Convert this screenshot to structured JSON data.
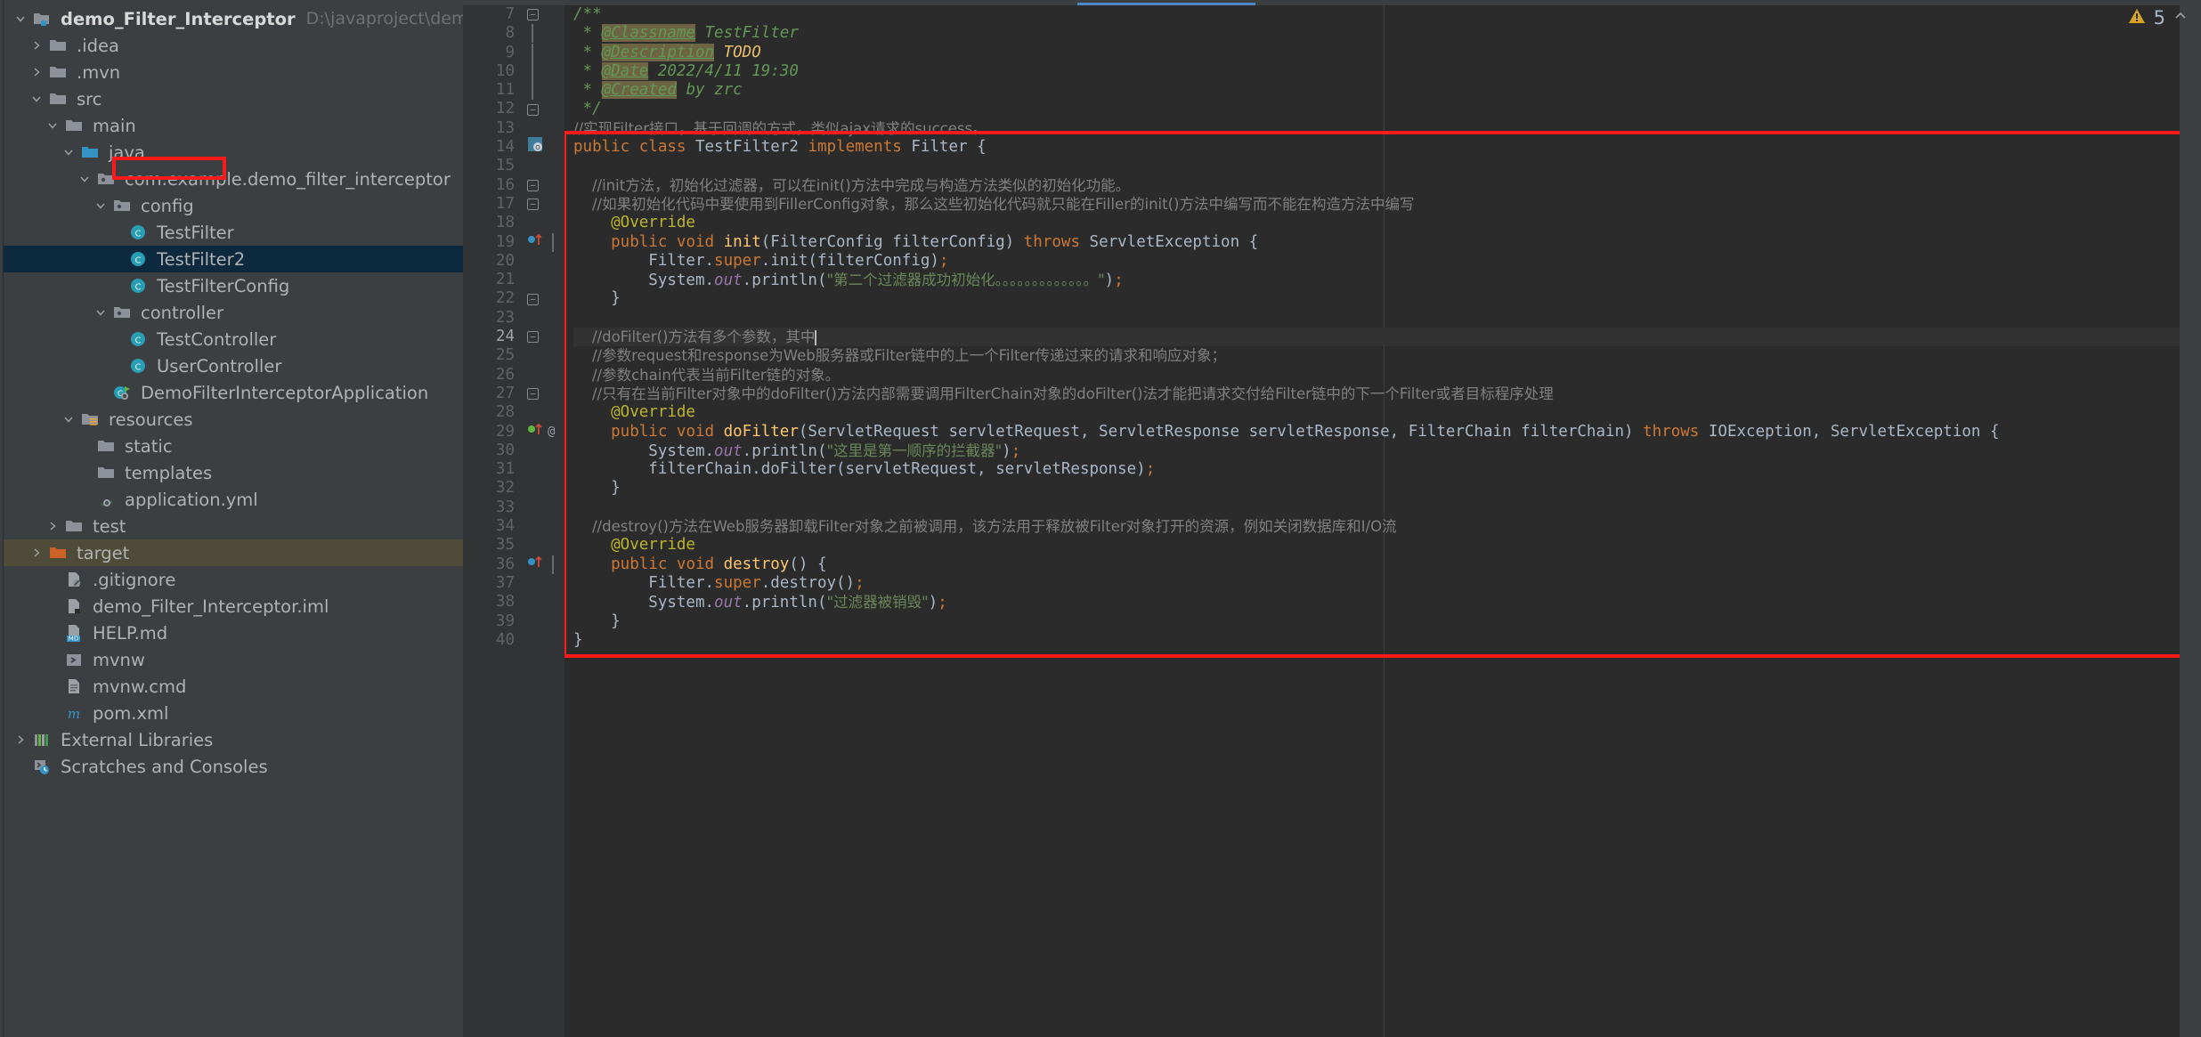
{
  "project_tree": {
    "items": [
      {
        "label": "demo_Filter_Interceptor",
        "path_hint": "D:\\javaproject\\demo_Filt",
        "indent": 0,
        "arrow": "down",
        "icon": "module-folder-icon",
        "bold": true,
        "state": "normal"
      },
      {
        "label": ".idea",
        "indent": 1,
        "arrow": "right",
        "icon": "folder-icon",
        "state": "normal"
      },
      {
        "label": ".mvn",
        "indent": 1,
        "arrow": "right",
        "icon": "folder-icon",
        "state": "normal"
      },
      {
        "label": "src",
        "indent": 1,
        "arrow": "down",
        "icon": "folder-icon",
        "state": "normal"
      },
      {
        "label": "main",
        "indent": 2,
        "arrow": "down",
        "icon": "folder-icon",
        "state": "normal"
      },
      {
        "label": "java",
        "indent": 3,
        "arrow": "down",
        "icon": "source-folder-icon",
        "state": "normal"
      },
      {
        "label": "com.example.demo_filter_interceptor",
        "indent": 4,
        "arrow": "down",
        "icon": "package-icon",
        "state": "normal"
      },
      {
        "label": "config",
        "indent": 5,
        "arrow": "down",
        "icon": "package-icon",
        "state": "normal"
      },
      {
        "label": "TestFilter",
        "indent": 6,
        "arrow": "none",
        "icon": "java-class-icon",
        "state": "normal"
      },
      {
        "label": "TestFilter2",
        "indent": 6,
        "arrow": "none",
        "icon": "java-class-icon",
        "state": "selected"
      },
      {
        "label": "TestFilterConfig",
        "indent": 6,
        "arrow": "none",
        "icon": "java-class-icon",
        "state": "normal"
      },
      {
        "label": "controller",
        "indent": 5,
        "arrow": "down",
        "icon": "package-icon",
        "state": "normal"
      },
      {
        "label": "TestController",
        "indent": 6,
        "arrow": "none",
        "icon": "java-class-icon",
        "state": "normal"
      },
      {
        "label": "UserController",
        "indent": 6,
        "arrow": "none",
        "icon": "java-class-icon",
        "state": "normal"
      },
      {
        "label": "DemoFilterInterceptorApplication",
        "indent": 5,
        "arrow": "none",
        "icon": "spring-boot-class-icon",
        "state": "normal"
      },
      {
        "label": "resources",
        "indent": 3,
        "arrow": "down",
        "icon": "resources-folder-icon",
        "state": "normal"
      },
      {
        "label": "static",
        "indent": 4,
        "arrow": "none",
        "icon": "folder-icon",
        "state": "normal"
      },
      {
        "label": "templates",
        "indent": 4,
        "arrow": "none",
        "icon": "folder-icon",
        "state": "normal"
      },
      {
        "label": "application.yml",
        "indent": 4,
        "arrow": "none",
        "icon": "spring-yaml-icon",
        "state": "normal"
      },
      {
        "label": "test",
        "indent": 2,
        "arrow": "right",
        "icon": "folder-icon",
        "state": "normal"
      },
      {
        "label": "target",
        "indent": 1,
        "arrow": "right",
        "icon": "excluded-folder-icon",
        "state": "highlight"
      },
      {
        "label": ".gitignore",
        "indent": 2,
        "arrow": "none",
        "icon": "gitignore-file-icon",
        "state": "normal"
      },
      {
        "label": "demo_Filter_Interceptor.iml",
        "indent": 2,
        "arrow": "none",
        "icon": "iml-file-icon",
        "state": "normal"
      },
      {
        "label": "HELP.md",
        "indent": 2,
        "arrow": "none",
        "icon": "markdown-file-icon",
        "state": "normal"
      },
      {
        "label": "mvnw",
        "indent": 2,
        "arrow": "none",
        "icon": "shell-script-icon",
        "state": "normal"
      },
      {
        "label": "mvnw.cmd",
        "indent": 2,
        "arrow": "none",
        "icon": "cmd-file-icon",
        "state": "normal"
      },
      {
        "label": "pom.xml",
        "indent": 2,
        "arrow": "none",
        "icon": "maven-pom-icon",
        "state": "normal"
      },
      {
        "label": "External Libraries",
        "indent": 0,
        "arrow": "right",
        "icon": "external-libraries-icon",
        "state": "normal"
      },
      {
        "label": "Scratches and Consoles",
        "indent": 0,
        "arrow": "none",
        "icon": "scratches-icon",
        "state": "normal"
      }
    ]
  },
  "editor": {
    "first_line_number": 7,
    "current_line_number": 24,
    "caret_line_number": 24,
    "lines": [
      {
        "n": 7,
        "mark": "fold-open",
        "tokens": [
          {
            "t": "/**",
            "c": "jdoc"
          }
        ]
      },
      {
        "n": 8,
        "mark": "fold-bar",
        "tokens": [
          {
            "t": " * ",
            "c": "jdoc"
          },
          {
            "t": "@Classname",
            "c": "jtag"
          },
          {
            "t": " TestFilter",
            "c": "jval"
          }
        ]
      },
      {
        "n": 9,
        "mark": "fold-bar",
        "tokens": [
          {
            "t": " * ",
            "c": "jdoc"
          },
          {
            "t": "@Description",
            "c": "jtag"
          },
          {
            "t": " ",
            "c": "jval"
          },
          {
            "t": "TODO",
            "c": "todo"
          }
        ]
      },
      {
        "n": 10,
        "mark": "fold-bar",
        "tokens": [
          {
            "t": " * ",
            "c": "jdoc"
          },
          {
            "t": "@Date",
            "c": "jtag"
          },
          {
            "t": " 2022/4/11 19:30",
            "c": "jval"
          }
        ]
      },
      {
        "n": 11,
        "mark": "fold-bar",
        "tokens": [
          {
            "t": " * ",
            "c": "jdoc"
          },
          {
            "t": "@Created",
            "c": "jtag"
          },
          {
            "t": " by zrc",
            "c": "jval"
          }
        ]
      },
      {
        "n": 12,
        "mark": "fold-close",
        "tokens": [
          {
            "t": " */",
            "c": "jdoc"
          }
        ]
      },
      {
        "n": 13,
        "mark": "",
        "tokens": [
          {
            "t": "//实现Filter接口，基于回调的方式，类似ajax请求的success。",
            "c": "cmt"
          }
        ]
      },
      {
        "n": 14,
        "mark": "impl-gutter",
        "tokens": [
          {
            "t": "public ",
            "c": "kw"
          },
          {
            "t": "class ",
            "c": "kw"
          },
          {
            "t": "TestFilter2 ",
            "c": "cls"
          },
          {
            "t": "implements ",
            "c": "kw"
          },
          {
            "t": "Filter {",
            "c": "cls"
          }
        ]
      },
      {
        "n": 15,
        "mark": "",
        "tokens": [
          {
            "t": "",
            "c": "plain"
          }
        ]
      },
      {
        "n": 16,
        "mark": "fold-open-sm",
        "tokens": [
          {
            "t": "    //init方法，初始化过滤器，可以在init()方法中完成与构造方法类似的初始化功能。",
            "c": "cmt"
          }
        ]
      },
      {
        "n": 17,
        "mark": "fold-close-sm",
        "tokens": [
          {
            "t": "    //如果初始化代码中要使用到FillerConfig对象，那么这些初始化代码就只能在Filler的init()方法中编写而不能在构造方法中编写",
            "c": "cmt"
          }
        ]
      },
      {
        "n": 18,
        "mark": "",
        "tokens": [
          {
            "t": "    @Override",
            "c": "anno"
          }
        ]
      },
      {
        "n": 19,
        "mark": "override-impl",
        "tokens": [
          {
            "t": "    public ",
            "c": "kw"
          },
          {
            "t": "void ",
            "c": "kw"
          },
          {
            "t": "init",
            "c": "meth"
          },
          {
            "t": "(FilterConfig filterConfig) ",
            "c": "plain"
          },
          {
            "t": "throws ",
            "c": "kw"
          },
          {
            "t": "ServletException {",
            "c": "plain"
          }
        ]
      },
      {
        "n": 20,
        "mark": "",
        "tokens": [
          {
            "t": "        Filter.",
            "c": "plain"
          },
          {
            "t": "super",
            "c": "kw"
          },
          {
            "t": ".init(filterConfig)",
            "c": "plain"
          },
          {
            "t": ";",
            "c": "kw"
          }
        ]
      },
      {
        "n": 21,
        "mark": "",
        "tokens": [
          {
            "t": "        System.",
            "c": "plain"
          },
          {
            "t": "out",
            "c": "fld"
          },
          {
            "t": ".println(",
            "c": "plain"
          },
          {
            "t": "\"第二个过滤器成功初始化。。。。。。。。。。。。。\"",
            "c": "str"
          },
          {
            "t": ")",
            "c": "plain"
          },
          {
            "t": ";",
            "c": "kw"
          }
        ]
      },
      {
        "n": 22,
        "mark": "fold-close-sm",
        "tokens": [
          {
            "t": "    }",
            "c": "plain"
          }
        ]
      },
      {
        "n": 23,
        "mark": "",
        "tokens": [
          {
            "t": "",
            "c": "plain"
          }
        ]
      },
      {
        "n": 24,
        "mark": "fold-open-sm",
        "tokens": [
          {
            "t": "    //doFilter()方法有多个参数，其中",
            "c": "cmt"
          }
        ]
      },
      {
        "n": 25,
        "mark": "",
        "tokens": [
          {
            "t": "    //参数request和response为Web服务器或Filter链中的上一个Filter传递过来的请求和响应对象；",
            "c": "cmt"
          }
        ]
      },
      {
        "n": 26,
        "mark": "",
        "tokens": [
          {
            "t": "    //参数chain代表当前Filter链的对象。",
            "c": "cmt"
          }
        ]
      },
      {
        "n": 27,
        "mark": "fold-close-sm",
        "tokens": [
          {
            "t": "    //只有在当前Filter对象中的doFilter()方法内部需要调用FilterChain对象的doFilter()法才能把请求交付给Filter链中的下一个Filter或者目标程序处理",
            "c": "cmt"
          }
        ]
      },
      {
        "n": 28,
        "mark": "",
        "tokens": [
          {
            "t": "    @Override",
            "c": "anno"
          }
        ]
      },
      {
        "n": 29,
        "mark": "override-impl-at",
        "tokens": [
          {
            "t": "    public ",
            "c": "kw"
          },
          {
            "t": "void ",
            "c": "kw"
          },
          {
            "t": "doFilter",
            "c": "meth"
          },
          {
            "t": "(ServletRequest servletRequest, ServletResponse servletResponse, FilterChain filterChain) ",
            "c": "plain"
          },
          {
            "t": "throws ",
            "c": "kw"
          },
          {
            "t": "IOException, ServletException {",
            "c": "plain"
          }
        ]
      },
      {
        "n": 30,
        "mark": "",
        "tokens": [
          {
            "t": "        System.",
            "c": "plain"
          },
          {
            "t": "out",
            "c": "fld"
          },
          {
            "t": ".println(",
            "c": "plain"
          },
          {
            "t": "\"这里是第一顺序的拦截器\"",
            "c": "str"
          },
          {
            "t": ")",
            "c": "plain"
          },
          {
            "t": ";",
            "c": "kw"
          }
        ]
      },
      {
        "n": 31,
        "mark": "",
        "tokens": [
          {
            "t": "        filterChain.doFilter(servletRequest, servletResponse)",
            "c": "plain"
          },
          {
            "t": ";",
            "c": "kw"
          }
        ]
      },
      {
        "n": 32,
        "mark": "",
        "tokens": [
          {
            "t": "    }",
            "c": "plain"
          }
        ]
      },
      {
        "n": 33,
        "mark": "",
        "tokens": [
          {
            "t": "",
            "c": "plain"
          }
        ]
      },
      {
        "n": 34,
        "mark": "",
        "tokens": [
          {
            "t": "    //destroy()方法在Web服务器卸载Filter对象之前被调用，该方法用于释放被Filter对象打开的资源，例如关闭数据库和I/O流",
            "c": "cmt"
          }
        ]
      },
      {
        "n": 35,
        "mark": "",
        "tokens": [
          {
            "t": "    @Override",
            "c": "anno"
          }
        ]
      },
      {
        "n": 36,
        "mark": "override-impl",
        "tokens": [
          {
            "t": "    public ",
            "c": "kw"
          },
          {
            "t": "void ",
            "c": "kw"
          },
          {
            "t": "destroy",
            "c": "meth"
          },
          {
            "t": "() {",
            "c": "plain"
          }
        ]
      },
      {
        "n": 37,
        "mark": "",
        "tokens": [
          {
            "t": "        Filter.",
            "c": "plain"
          },
          {
            "t": "super",
            "c": "kw"
          },
          {
            "t": ".destroy()",
            "c": "plain"
          },
          {
            "t": ";",
            "c": "kw"
          }
        ]
      },
      {
        "n": 38,
        "mark": "",
        "tokens": [
          {
            "t": "        System.",
            "c": "plain"
          },
          {
            "t": "out",
            "c": "fld"
          },
          {
            "t": ".println(",
            "c": "plain"
          },
          {
            "t": "\"过滤器被销毁\"",
            "c": "str"
          },
          {
            "t": ")",
            "c": "plain"
          },
          {
            "t": ";",
            "c": "kw"
          }
        ]
      },
      {
        "n": 39,
        "mark": "",
        "tokens": [
          {
            "t": "    }",
            "c": "plain"
          }
        ]
      },
      {
        "n": 40,
        "mark": "",
        "tokens": [
          {
            "t": "}",
            "c": "plain"
          }
        ]
      }
    ]
  },
  "inspection": {
    "warning_icon": "warning-triangle-icon",
    "warning_count": "5",
    "collapse_icon": "chevron-up-icon"
  },
  "annotations": {
    "tree_box_label": "TestFilter2",
    "code_box_label": "class-body-region"
  },
  "colors": {
    "accent_blue": "#4a88c7",
    "selection_blue": "#0d293e",
    "annotation_red": "#ff1a1a",
    "editor_bg": "#2b2b2b",
    "panel_bg": "#3c3f41",
    "warning_yellow": "#d9a520"
  }
}
